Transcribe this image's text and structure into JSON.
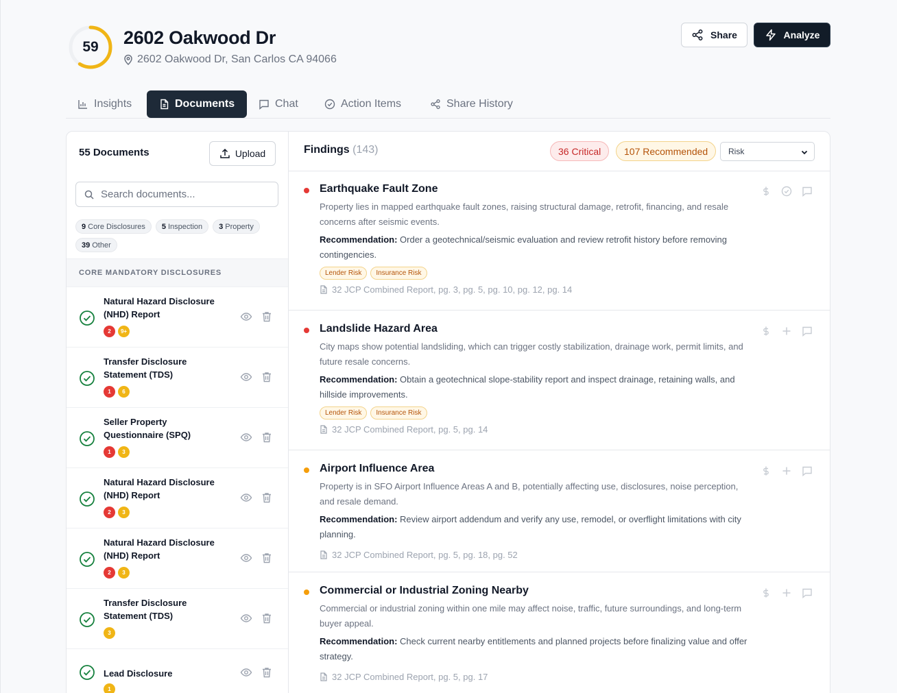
{
  "property": {
    "score": "59",
    "score_fraction": 0.59,
    "title": "2602 Oakwood Dr",
    "address": "2602 Oakwood Dr, San Carlos CA 94066"
  },
  "actions": {
    "share": "Share",
    "analyze": "Analyze"
  },
  "tabs": [
    {
      "label": "Insights",
      "icon": "bar-chart-icon"
    },
    {
      "label": "Documents",
      "icon": "document-icon",
      "active": true
    },
    {
      "label": "Chat",
      "icon": "chat-icon"
    },
    {
      "label": "Action Items",
      "icon": "check-circle-icon"
    },
    {
      "label": "Share History",
      "icon": "share-icon"
    }
  ],
  "documents": {
    "count_label": "55 Documents",
    "upload": "Upload",
    "search_placeholder": "Search documents...",
    "chips": [
      {
        "count": "9",
        "label": "Core Disclosures"
      },
      {
        "count": "5",
        "label": "Inspection"
      },
      {
        "count": "3",
        "label": "Property"
      },
      {
        "count": "39",
        "label": "Other"
      }
    ],
    "section": "CORE MANDATORY DISCLOSURES",
    "items": [
      {
        "name": "Natural Hazard Disclosure (NHD) Report",
        "red": "2",
        "amber": "9+"
      },
      {
        "name": "Transfer Disclosure Statement (TDS)",
        "red": "1",
        "amber": "6"
      },
      {
        "name": "Seller Property Questionnaire (SPQ)",
        "red": "1",
        "amber": "3"
      },
      {
        "name": "Natural Hazard Disclosure (NHD) Report",
        "red": "2",
        "amber": "3"
      },
      {
        "name": "Natural Hazard Disclosure (NHD) Report",
        "red": "2",
        "amber": "3"
      },
      {
        "name": "Transfer Disclosure Statement (TDS)",
        "red": "",
        "amber": "3"
      },
      {
        "name": "Lead Disclosure",
        "red": "",
        "amber": "1"
      }
    ]
  },
  "findings": {
    "title": "Findings",
    "count": "(143)",
    "critical": "36 Critical",
    "recommended": "107 Recommended",
    "sort": "Risk",
    "items": [
      {
        "severity": "critical",
        "title": "Earthquake Fault Zone",
        "description": "Property lies in mapped earthquake fault zones, raising structural damage, retrofit, financing, and resale concerns after seismic events.",
        "rec_label": "Recommendation:",
        "recommendation": "Order a geotechnical/seismic evaluation and review retrofit history before removing contingencies.",
        "tags": [
          "Lender Risk",
          "Insurance Risk"
        ],
        "source": "32 JCP Combined Report, pg. 3, pg. 5, pg. 10, pg. 12, pg. 14",
        "second_action": "check-circle-icon"
      },
      {
        "severity": "critical",
        "title": "Landslide Hazard Area",
        "description": "City maps show potential landsliding, which can trigger costly stabilization, drainage work, permit limits, and future resale concerns.",
        "rec_label": "Recommendation:",
        "recommendation": "Obtain a geotechnical slope-stability report and inspect drainage, retaining walls, and hillside improvements.",
        "tags": [
          "Lender Risk",
          "Insurance Risk"
        ],
        "source": "32 JCP Combined Report, pg. 5, pg. 14",
        "second_action": "plus-icon"
      },
      {
        "severity": "recommended",
        "title": "Airport Influence Area",
        "description": "Property is in SFO Airport Influence Areas A and B, potentially affecting use, disclosures, noise perception, and resale demand.",
        "rec_label": "Recommendation:",
        "recommendation": "Review airport addendum and verify any use, remodel, or overflight limitations with city planning.",
        "tags": [],
        "source": "32 JCP Combined Report, pg. 5, pg. 18, pg. 52",
        "second_action": "plus-icon"
      },
      {
        "severity": "recommended",
        "title": "Commercial or Industrial Zoning Nearby",
        "description": "Commercial or industrial zoning within one mile may affect noise, traffic, future surroundings, and long-term buyer appeal.",
        "rec_label": "Recommendation:",
        "recommendation": "Check current nearby entitlements and planned projects before finalizing value and offer strategy.",
        "tags": [],
        "source": "32 JCP Combined Report, pg. 5, pg. 17",
        "second_action": "plus-icon"
      }
    ]
  },
  "colors": {
    "score_ring": "#f0b516",
    "critical": "#e53935",
    "recommended": "#f59e0b",
    "dark": "#121c28",
    "success": "#15803d"
  }
}
